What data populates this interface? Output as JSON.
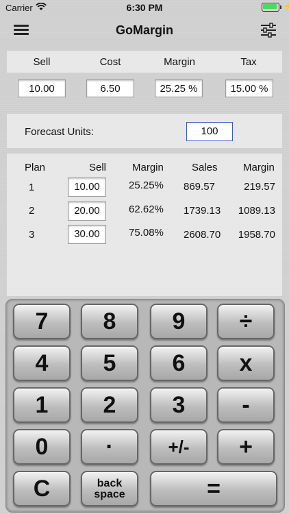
{
  "status": {
    "carrier": "Carrier",
    "time": "6:30 PM"
  },
  "nav": {
    "title": "GoMargin"
  },
  "top": {
    "headers": [
      "Sell",
      "Cost",
      "Margin",
      "Tax"
    ],
    "values": [
      "10.00",
      "6.50",
      "25.25 %",
      "15.00 %"
    ]
  },
  "forecast": {
    "label": "Forecast Units:",
    "value": "100"
  },
  "plans": {
    "headers": [
      "Plan",
      "Sell",
      "Margin",
      "Sales",
      "Margin"
    ],
    "rows": [
      {
        "plan": "1",
        "sell": "10.00",
        "margin_pct": "25.25%",
        "sales": "869.57",
        "margin": "219.57"
      },
      {
        "plan": "2",
        "sell": "20.00",
        "margin_pct": "62.62%",
        "sales": "1739.13",
        "margin": "1089.13"
      },
      {
        "plan": "3",
        "sell": "30.00",
        "margin_pct": "75.08%",
        "sales": "2608.70",
        "margin": "1958.70"
      }
    ]
  },
  "keypad": {
    "k7": "7",
    "k8": "8",
    "k9": "9",
    "div": "÷",
    "k4": "4",
    "k5": "5",
    "k6": "6",
    "mul": "x",
    "k1": "1",
    "k2": "2",
    "k3": "3",
    "sub": "-",
    "k0": "0",
    "dot": "·",
    "sign": "+/-",
    "add": "+",
    "clear": "C",
    "back_line1": "back",
    "back_line2": "space",
    "equals": "="
  }
}
